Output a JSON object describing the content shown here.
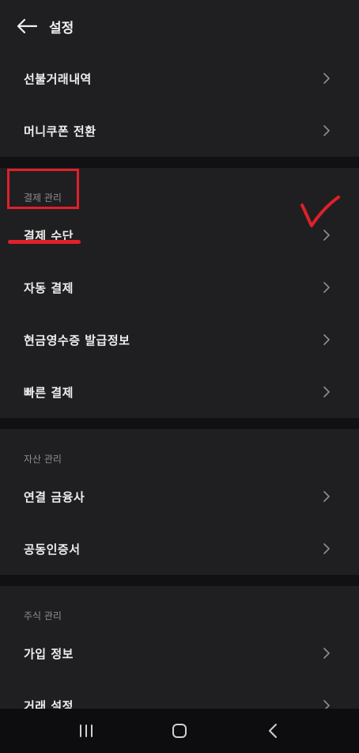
{
  "header": {
    "title": "설정"
  },
  "sections": [
    {
      "items": [
        {
          "label": "선불거래내역"
        },
        {
          "label": "머니쿠폰 전환"
        }
      ]
    },
    {
      "label": "결제 관리",
      "items": [
        {
          "label": "결제 수단"
        },
        {
          "label": "자동 결제"
        },
        {
          "label": "현금영수증 발급정보"
        },
        {
          "label": "빠른 결제"
        }
      ]
    },
    {
      "label": "자산 관리",
      "items": [
        {
          "label": "연결 금융사"
        },
        {
          "label": "공동인증서"
        }
      ]
    },
    {
      "label": "주식 관리",
      "items": [
        {
          "label": "가입 정보"
        },
        {
          "label": "거래 설정"
        }
      ]
    }
  ],
  "colors": {
    "background": "#111113",
    "surface": "#1f1f21",
    "annotation": "#e0202a",
    "muted_text": "#8e8e93"
  },
  "icons": {
    "back": "arrow-left-icon",
    "chevron": "chevron-right-icon",
    "nav_recent": "recent-apps-icon",
    "nav_home": "home-icon",
    "nav_back": "nav-back-icon"
  }
}
